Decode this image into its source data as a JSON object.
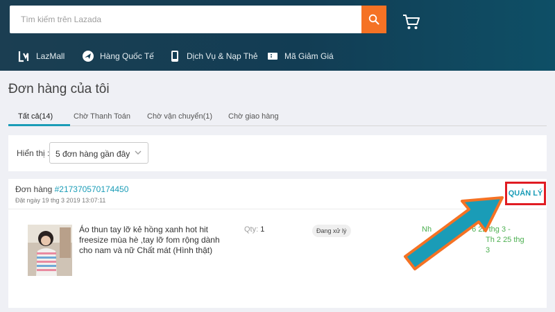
{
  "search": {
    "placeholder": "Tìm kiếm trên Lazada"
  },
  "icons": {
    "search": "search-icon",
    "cart": "cart-icon",
    "lazmall": "lazmall-icon",
    "plane": "plane-icon",
    "phone": "phone-icon",
    "voucher": "voucher-icon",
    "chevron": "chevron-down-icon"
  },
  "colors": {
    "header_bg": "#123d54",
    "search_button": "#f57224",
    "accent": "#1a9cb7",
    "highlight_border": "#e01b22",
    "arrow_fill": "#1a9cb7",
    "arrow_outline": "#f57224",
    "delivery_text": "#4caf50"
  },
  "nav": [
    {
      "label": "LazMall"
    },
    {
      "label": "Hàng Quốc Tế"
    },
    {
      "label": "Dịch Vụ & Nạp Thẻ"
    },
    {
      "label": "Mã Giảm Giá"
    }
  ],
  "page_title": "Đơn hàng của tôi",
  "tabs": [
    {
      "label": "Tất cả(14)",
      "active": true
    },
    {
      "label": "Chờ Thanh Toán"
    },
    {
      "label": "Chờ vận chuyển(1)"
    },
    {
      "label": "Chờ giao hàng"
    }
  ],
  "filter": {
    "label": "Hiển thị :",
    "selected": "5 đơn hàng gần đây"
  },
  "order": {
    "label": "Đơn hàng",
    "id": "#217370570174450",
    "date": "Đặt ngày 19 thg 3 2019 13:07:11",
    "manage_label": "QUẢN LÝ",
    "item": {
      "name": "Áo thun tay lỡ kẻ hồng xanh hot hit freesize mùa hè ,tay lỡ fom rộng dành cho nam và nữ Chất mát (Hình thật)",
      "qty_label": "Qty:",
      "qty": "1",
      "status": "Đang xử lý",
      "delivery_line1": "Nh                   6 22 thg 3 -",
      "delivery_line2": "Th 2 25 thg 3"
    }
  }
}
